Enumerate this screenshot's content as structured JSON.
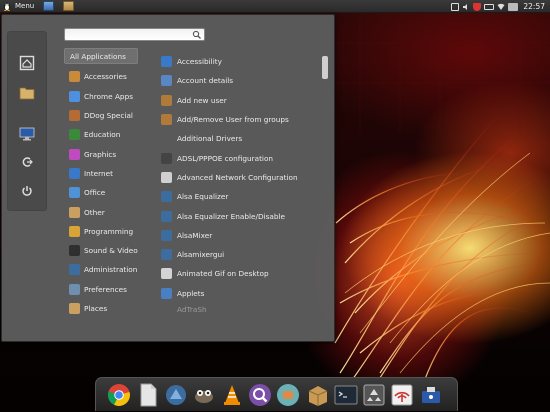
{
  "top_panel": {
    "menu_label": "Menu",
    "clock": "22:57",
    "launchers": [
      "home-launcher-icon",
      "folder-launcher-icon"
    ],
    "tray_icons": [
      "network-icon",
      "volume-icon",
      "shield-icon",
      "battery-icon",
      "wifi-icon",
      "keyboard-icon"
    ]
  },
  "menu": {
    "search": {
      "value": "",
      "placeholder": ""
    },
    "favorites": [
      "home-folder-icon",
      "folder-icon",
      "desktop-icon",
      "logout-icon",
      "power-icon"
    ],
    "categories": [
      {
        "label": "All Applications",
        "icon": "none",
        "color": ""
      },
      {
        "label": "Accessories",
        "icon": "accessories-icon",
        "color": "#c98a3a"
      },
      {
        "label": "Chrome Apps",
        "icon": "chrome-icon",
        "color": "#4f8fe0"
      },
      {
        "label": "DDog Special",
        "icon": "ddog-icon",
        "color": "#b46b34"
      },
      {
        "label": "Education",
        "icon": "education-icon",
        "color": "#3b8a3b"
      },
      {
        "label": "Graphics",
        "icon": "graphics-icon",
        "color": "#c04ac0"
      },
      {
        "label": "Internet",
        "icon": "internet-icon",
        "color": "#3a79c9"
      },
      {
        "label": "Office",
        "icon": "office-icon",
        "color": "#4f92d6"
      },
      {
        "label": "Other",
        "icon": "other-icon",
        "color": "#c9a060"
      },
      {
        "label": "Programming",
        "icon": "programming-icon",
        "color": "#d8a437"
      },
      {
        "label": "Sound & Video",
        "icon": "sound-video-icon",
        "color": "#2f2f2f"
      },
      {
        "label": "Administration",
        "icon": "administration-icon",
        "color": "#3d6d9e"
      },
      {
        "label": "Preferences",
        "icon": "preferences-icon",
        "color": "#6f8fae"
      },
      {
        "label": "Places",
        "icon": "places-icon",
        "color": "#c9a060"
      }
    ],
    "applications": [
      {
        "label": "Accessibility",
        "icon": "accessibility-icon",
        "color": "#3a78c8"
      },
      {
        "label": "Account details",
        "icon": "account-icon",
        "color": "#5a86c4"
      },
      {
        "label": "Add new user",
        "icon": "add-user-icon",
        "color": "#b07a3a"
      },
      {
        "label": "Add/Remove User from groups",
        "icon": "user-groups-icon",
        "color": "#b07a3a"
      },
      {
        "label": "Additional Drivers",
        "icon": "none",
        "color": ""
      },
      {
        "label": "ADSL/PPPOE configuration",
        "icon": "adsl-icon",
        "color": "#444444"
      },
      {
        "label": "Advanced Network Configuration",
        "icon": "network-config-icon",
        "color": "#d0d0d0"
      },
      {
        "label": "Alsa Equalizer",
        "icon": "alsa-icon",
        "color": "#3d6d9e"
      },
      {
        "label": "Alsa Equalizer Enable/Disable",
        "icon": "alsa-icon",
        "color": "#3d6d9e"
      },
      {
        "label": "AlsaMixer",
        "icon": "alsamixer-icon",
        "color": "#3d6d9e"
      },
      {
        "label": "Alsamixergui",
        "icon": "alsamixer-icon",
        "color": "#3d6d9e"
      },
      {
        "label": "Animated Gif on Desktop",
        "icon": "gif-icon",
        "color": "#d4d4d4"
      },
      {
        "label": "Applets",
        "icon": "applets-icon",
        "color": "#4a7fc4"
      },
      {
        "label": "AdTraSh",
        "icon": "none",
        "color": ""
      }
    ]
  },
  "dock": {
    "items": [
      "chrome-icon",
      "text-editor-icon",
      "system-tools-icon",
      "gimp-icon",
      "vlc-icon",
      "search-icon",
      "files-icon",
      "archive-icon",
      "terminal-icon",
      "recycle-icon",
      "network-icon",
      "usb-icon"
    ]
  }
}
